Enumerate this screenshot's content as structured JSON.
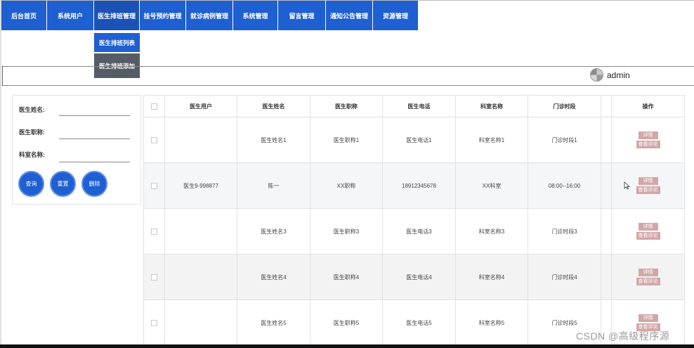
{
  "nav": {
    "items": [
      {
        "label": "后台首页"
      },
      {
        "label": "系统用户"
      },
      {
        "label": "医生排班管理"
      },
      {
        "label": "挂号预约管理"
      },
      {
        "label": "就诊病例管理"
      },
      {
        "label": "系统管理"
      },
      {
        "label": "留言管理"
      },
      {
        "label": "通知公告管理"
      },
      {
        "label": "资源管理"
      }
    ]
  },
  "dropdown": {
    "items": [
      {
        "label": "医生排班列表"
      },
      {
        "label": "医生排班添加"
      }
    ]
  },
  "header": {
    "username": "admin"
  },
  "search": {
    "doctor_name_label": "医生姓名:",
    "doctor_title_label": "医生职称:",
    "department_label": "科室名称:",
    "query_button": "查询",
    "reset_button": "重置",
    "delete_button": "删除"
  },
  "table": {
    "headers": [
      "医生用户",
      "医生姓名",
      "医生职称",
      "医生电话",
      "科室名称",
      "门诊时段",
      "操作"
    ],
    "detail_label": "详情",
    "review_label": "查看评论",
    "rows": [
      {
        "user": "",
        "name": "医生姓名1",
        "title": "医生职称1",
        "phone": "医生电话1",
        "dept": "科室名称1",
        "time": "门诊时段1"
      },
      {
        "user": "医生9-998877",
        "name": "陈一",
        "title": "XX职称",
        "phone": "18912345678",
        "dept": "XX科室",
        "time": "08:00--16:00"
      },
      {
        "user": "",
        "name": "医生姓名3",
        "title": "医生职称3",
        "phone": "医生电话3",
        "dept": "科室名称3",
        "time": "门诊时段3"
      },
      {
        "user": "",
        "name": "医生姓名4",
        "title": "医生职称4",
        "phone": "医生电话4",
        "dept": "科室名称4",
        "time": "门诊时段4"
      },
      {
        "user": "",
        "name": "医生姓名5",
        "title": "医生职称5",
        "phone": "医生电话5",
        "dept": "科室名称5",
        "time": "门诊时段5"
      }
    ]
  },
  "watermark": "CSDN @高级程序源",
  "colors": {
    "nav_blue": "#1e5fd1",
    "dropdown_gray": "#555c66",
    "op_button_pink": "#d2a7a7"
  }
}
